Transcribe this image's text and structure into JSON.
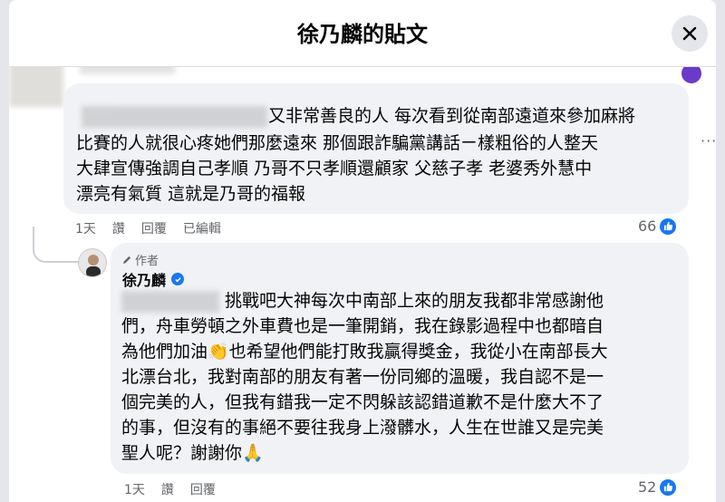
{
  "header": {
    "title": "徐乃麟的貼文",
    "close_icon": "close-icon"
  },
  "comment1": {
    "lines": [
      "又非常善良的人 每次看到從南部遠道來參加麻將",
      "比賽的人就很心疼她們那麼遠來 那個跟詐騙黨講話ㄧ樣粗俗的人整天",
      "大肆宣傳強調自己孝順 乃哥不只孝順還顧家 父慈子孝 老婆秀外慧中",
      "漂亮有氣質 這就是乃哥的福報"
    ],
    "meta": {
      "time": "1天",
      "like": "讚",
      "reply": "回覆",
      "edited": "已編輯"
    },
    "like_count": "66"
  },
  "reply": {
    "author_tag": "作者",
    "author_name": "徐乃麟",
    "lines": [
      "挑戰吧大神每次中南部上來的朋友我都非常感謝他",
      "們，舟車勞頓之外車費也是一筆開銷，我在錄影過程中也都暗自",
      "為他們加油👏也希望他們能打敗我贏得獎金，我從小在南部長大",
      "北漂台北，我對南部的朋友有著一份同鄉的溫暖，我自認不是一",
      "個完美的人，但我有錯我一定不閃躲該認錯道歉不是什麼大不了",
      "的事，但沒有的事絕不要往我身上潑髒水，人生在世誰又是完美",
      "聖人呢？謝謝你🙏"
    ],
    "meta": {
      "time": "1天",
      "like": "讚",
      "reply": "回覆"
    },
    "like_count": "52"
  },
  "colors": {
    "accent": "#1877f2",
    "bubble": "#f0f2f5",
    "meta": "#65676b"
  }
}
